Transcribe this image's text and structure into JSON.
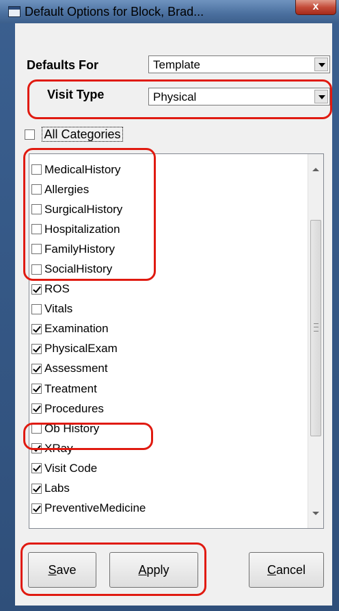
{
  "window": {
    "title": "Default Options for Block, Brad...",
    "close_label": "x"
  },
  "form": {
    "defaults_for_label": "Defaults For",
    "defaults_for_value": "Template",
    "visit_type_label": "Visit Type",
    "visit_type_value": "Physical"
  },
  "all_categories": {
    "label": "All Categories",
    "checked": false
  },
  "categories": [
    {
      "label": "MedicalHistory",
      "checked": false
    },
    {
      "label": "Allergies",
      "checked": false
    },
    {
      "label": "SurgicalHistory",
      "checked": false
    },
    {
      "label": "Hospitalization",
      "checked": false
    },
    {
      "label": "FamilyHistory",
      "checked": false
    },
    {
      "label": "SocialHistory",
      "checked": false
    },
    {
      "label": "ROS",
      "checked": true
    },
    {
      "label": "Vitals",
      "checked": false
    },
    {
      "label": "Examination",
      "checked": true
    },
    {
      "label": "PhysicalExam",
      "checked": true
    },
    {
      "label": "Assessment",
      "checked": true
    },
    {
      "label": "Treatment",
      "checked": true
    },
    {
      "label": "Procedures",
      "checked": true
    },
    {
      "label": "Ob History",
      "checked": false
    },
    {
      "label": "XRay",
      "checked": true
    },
    {
      "label": "Visit Code",
      "checked": true
    },
    {
      "label": "Labs",
      "checked": true
    },
    {
      "label": "PreventiveMedicine",
      "checked": true
    }
  ],
  "buttons": {
    "save": {
      "accel": "S",
      "rest": "ave"
    },
    "apply": {
      "accel": "A",
      "rest": "pply"
    },
    "cancel": {
      "accel": "C",
      "rest": "ancel"
    }
  },
  "colors": {
    "annotation": "#e01a10",
    "title_bar": "#4a6f9e",
    "close_button": "#c44c3a"
  }
}
